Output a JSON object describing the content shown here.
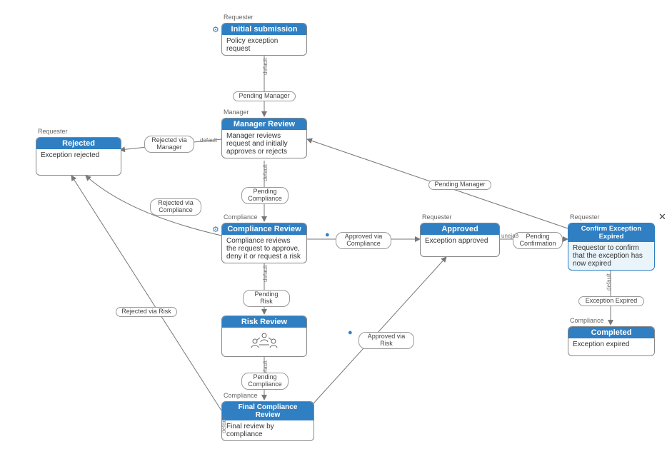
{
  "colors": {
    "accent_blue": "#2f7fc2",
    "edge_gray": "#777777"
  },
  "nodes": {
    "initial": {
      "swimlane": "Requester",
      "title": "Initial submission",
      "body": "Policy exception request"
    },
    "rejected": {
      "swimlane": "Requester",
      "title": "Rejected",
      "body": "Exception rejected"
    },
    "manager": {
      "swimlane": "Manager",
      "title": "Manager Review",
      "body": "Manager reviews request and initially approves or rejects"
    },
    "compliance": {
      "swimlane": "Compliance",
      "title": "Compliance Review",
      "body": "Compliance reviews the request to approve, deny it or request a risk"
    },
    "risk": {
      "swimlane": "",
      "title": "Risk Review",
      "body": ""
    },
    "final": {
      "swimlane": "Compliance",
      "title": "Final Compliance Review",
      "body": "Final review by compliance"
    },
    "approved": {
      "swimlane": "Requester",
      "title": "Approved",
      "body": "Exception approved"
    },
    "confirm": {
      "swimlane": "Requester",
      "title": "Confirm Exception Expired",
      "body": "Requestor to confirm that the exception has now expired"
    },
    "completed": {
      "swimlane": "Compliance",
      "title": "Completed",
      "body": "Exception expired"
    }
  },
  "edge_labels": {
    "pending_mgr_top": "Pending Manager",
    "rej_via_mgr": "Rejected via Manager",
    "pending_compliance": "Pending Compliance",
    "rej_via_compliance": "Rejected via Compliance",
    "approved_via_comp": "Approved via Compliance",
    "pending_risk": "Pending Risk",
    "rej_via_risk": "Rejected via Risk",
    "pending_compliance2": "Pending Compliance",
    "approved_via_risk": "Approved via Risk",
    "pending_confirm": "Pending Confirmation",
    "pending_mgr_back": "Pending Manager",
    "exception_expired": "Exception Expired",
    "unejao": "unejað"
  },
  "misc": {
    "default_word": "default",
    "close_x": "✕",
    "gear_icon": "⚙",
    "dot_icon": "●"
  }
}
